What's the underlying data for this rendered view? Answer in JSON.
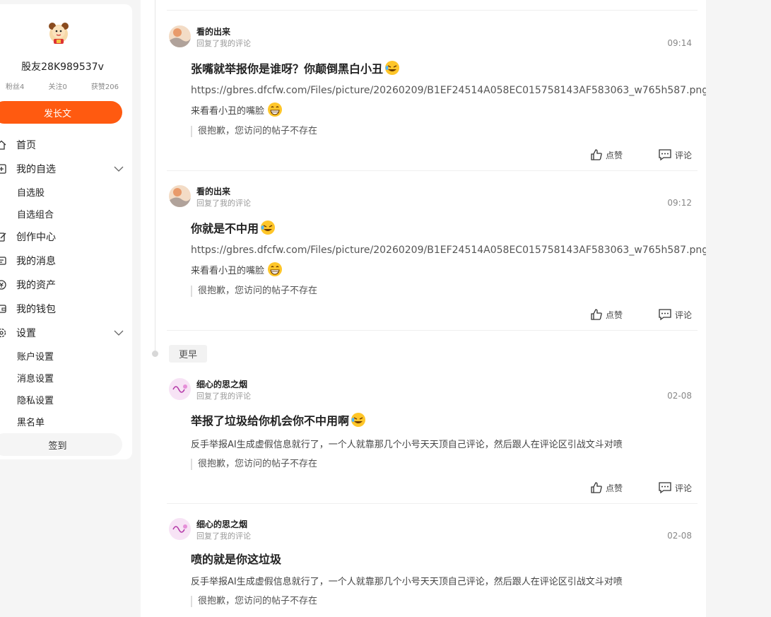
{
  "profile": {
    "username": "股友28K989537v",
    "fans": "粉丝4",
    "following": "关注0",
    "likes": "获赞206",
    "post_button": "发长文",
    "signin_button": "签到"
  },
  "menu": {
    "home": "首页",
    "watchlist": "我的自选",
    "watchlist_stocks": "自选股",
    "watchlist_portfolio": "自选组合",
    "creator_center": "创作中心",
    "messages": "我的消息",
    "assets": "我的资产",
    "wallet": "我的钱包",
    "settings": "设置",
    "account_settings": "账户设置",
    "message_settings": "消息设置",
    "privacy_settings": "隐私设置",
    "blacklist": "黑名单"
  },
  "timeline": {
    "earlier_label": "更早"
  },
  "replies": [
    {
      "author": "看的出来",
      "action": "回复了我的评论",
      "time": "09:14",
      "title": "张嘴就举报你是谁呀？你颠倒黑白小丑",
      "url": "https://gbres.dfcfw.com/Files/picture/20260209/B1EF24514A058EC015758143AF583063_w765h587.png",
      "text": "来看看小丑的嘴脸",
      "quote": "很抱歉，您访问的帖子不存在",
      "like_label": "点赞",
      "comment_label": "评论"
    },
    {
      "author": "看的出来",
      "action": "回复了我的评论",
      "time": "09:12",
      "title": "你就是不中用",
      "url": "https://gbres.dfcfw.com/Files/picture/20260209/B1EF24514A058EC015758143AF583063_w765h587.png",
      "text": "来看看小丑的嘴脸",
      "quote": "很抱歉，您访问的帖子不存在",
      "like_label": "点赞",
      "comment_label": "评论"
    },
    {
      "author": "细心的思之烟",
      "action": "回复了我的评论",
      "time": "02-08",
      "title": "举报了垃圾给你机会你不中用啊",
      "text": "反手举报AI生成虚假信息就行了，一个人就靠那几个小号天天顶自己评论，然后跟人在评论区引战文斗对喷",
      "quote": "很抱歉，您访问的帖子不存在",
      "like_label": "点赞",
      "comment_label": "评论"
    },
    {
      "author": "细心的思之烟",
      "action": "回复了我的评论",
      "time": "02-08",
      "title": "喷的就是你这垃圾",
      "text": "反手举报AI生成虚假信息就行了，一个人就靠那几个小号天天顶自己评论，然后跟人在评论区引战文斗对喷",
      "quote": "很抱歉，您访问的帖子不存在"
    }
  ],
  "colors": {
    "accent": "#ff5a10",
    "background": "#f5f5f5"
  }
}
